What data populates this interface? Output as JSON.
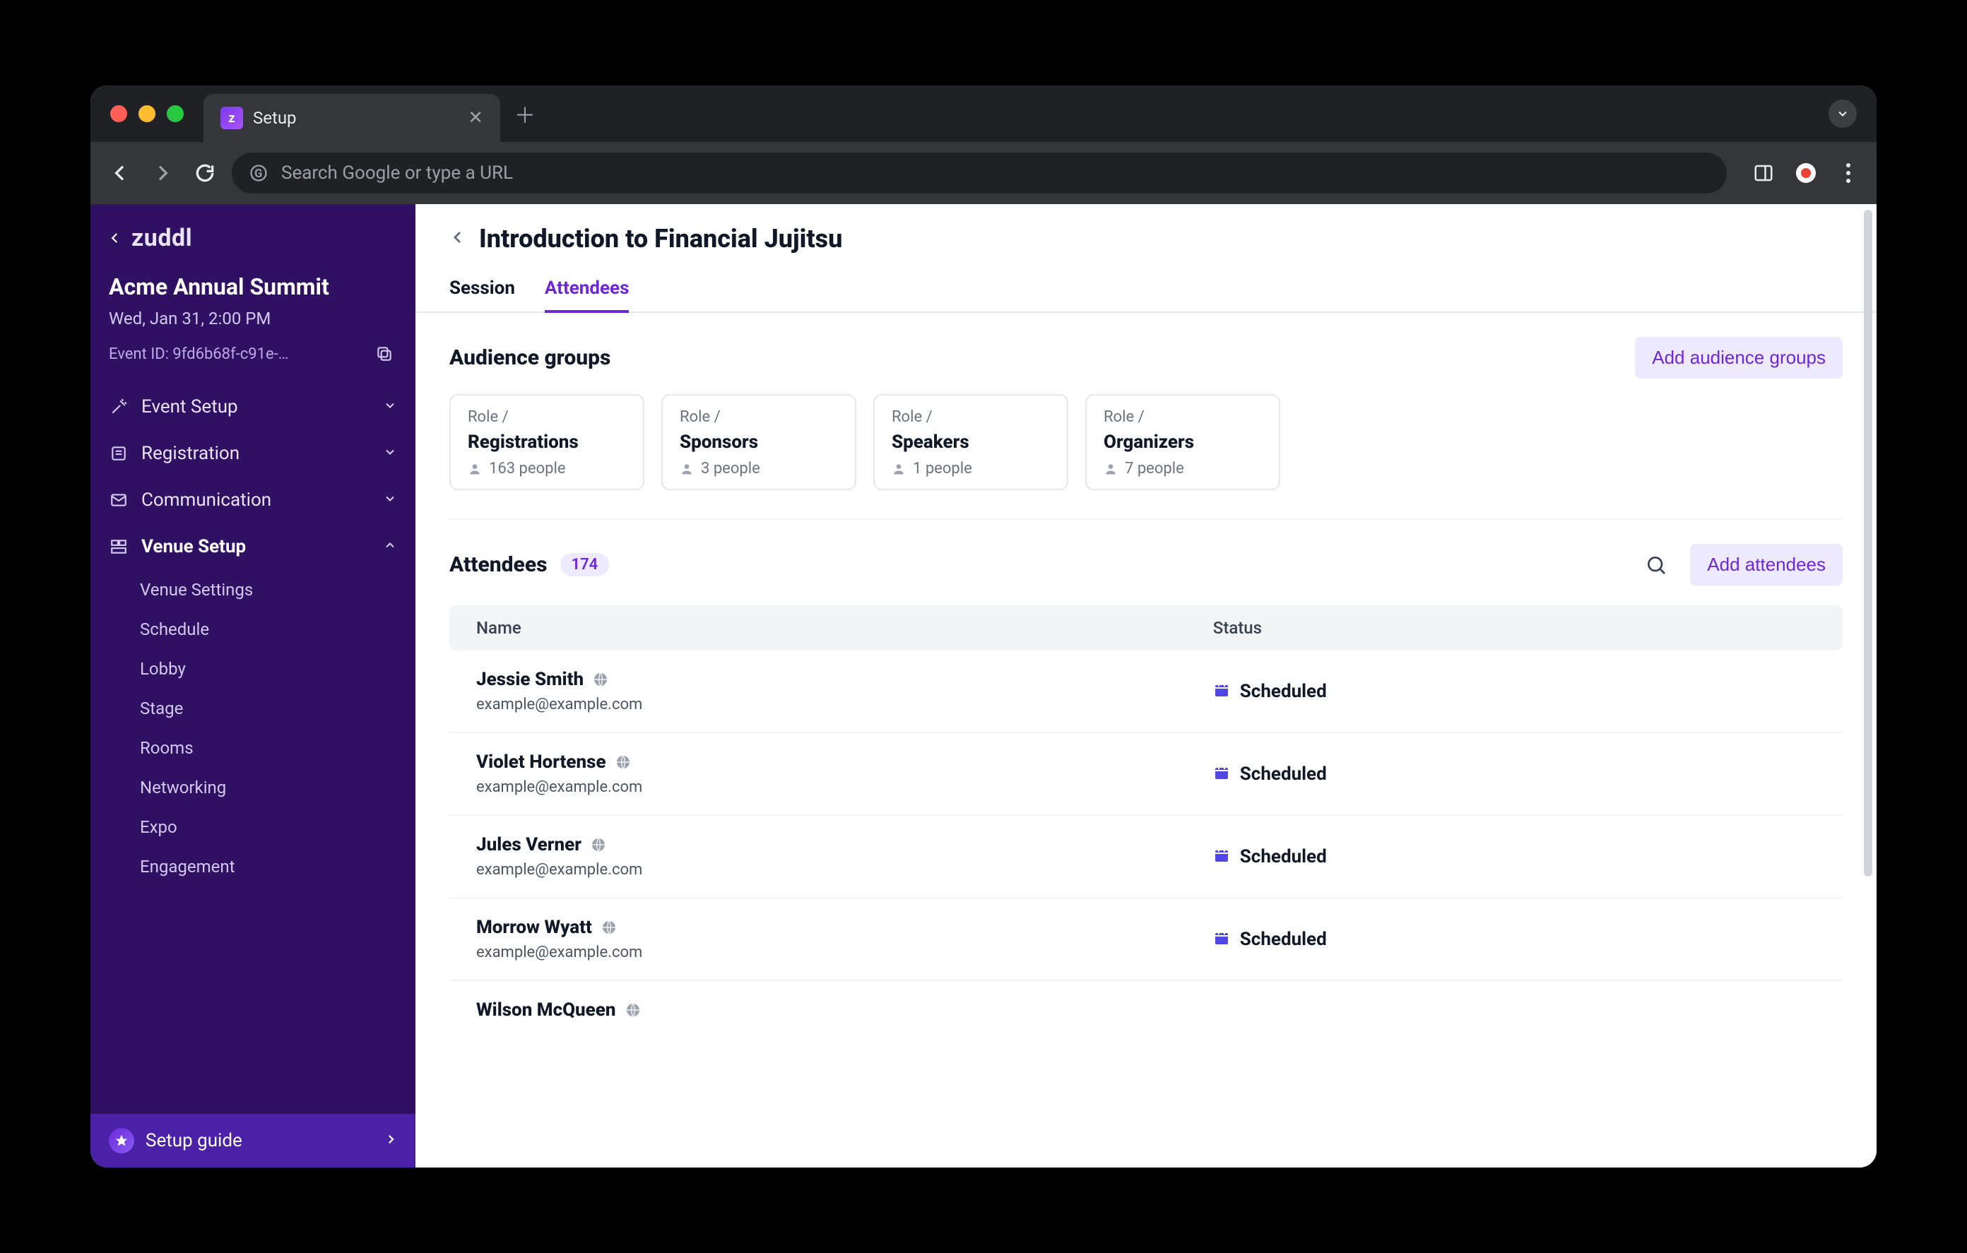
{
  "browser": {
    "tab_title": "Setup",
    "omnibox_placeholder": "Search Google or type a URL"
  },
  "sidebar": {
    "brand": "zuddl",
    "event_title": "Acme Annual Summit",
    "event_date": "Wed, Jan 31, 2:00 PM",
    "event_id_label": "Event ID: 9fd6b68f-c91e-…",
    "nav": [
      {
        "label": "Event Setup",
        "expanded": false
      },
      {
        "label": "Registration",
        "expanded": false
      },
      {
        "label": "Communication",
        "expanded": false
      },
      {
        "label": "Venue Setup",
        "expanded": true,
        "children": [
          "Venue Settings",
          "Schedule",
          "Lobby",
          "Stage",
          "Rooms",
          "Networking",
          "Expo",
          "Engagement"
        ]
      }
    ],
    "setup_guide": "Setup guide"
  },
  "page": {
    "title": "Introduction to Financial Jujitsu",
    "tabs": [
      {
        "label": "Session",
        "active": false
      },
      {
        "label": "Attendees",
        "active": true
      }
    ],
    "audience_section_title": "Audience groups",
    "add_groups_btn": "Add audience groups",
    "role_kicker": "Role /",
    "groups": [
      {
        "title": "Registrations",
        "count": "163 people"
      },
      {
        "title": "Sponsors",
        "count": "3 people"
      },
      {
        "title": "Speakers",
        "count": "1 people"
      },
      {
        "title": "Organizers",
        "count": "7 people"
      }
    ],
    "attendees_title": "Attendees",
    "attendees_count": "174",
    "add_attendees_btn": "Add attendees",
    "table": {
      "col_name": "Name",
      "col_status": "Status",
      "rows": [
        {
          "name": "Jessie Smith",
          "email": "example@example.com",
          "status": "Scheduled"
        },
        {
          "name": "Violet Hortense",
          "email": "example@example.com",
          "status": "Scheduled"
        },
        {
          "name": "Jules Verner",
          "email": "example@example.com",
          "status": "Scheduled"
        },
        {
          "name": "Morrow Wyatt",
          "email": "example@example.com",
          "status": "Scheduled"
        },
        {
          "name": "Wilson McQueen",
          "email": "",
          "status": ""
        }
      ]
    }
  }
}
